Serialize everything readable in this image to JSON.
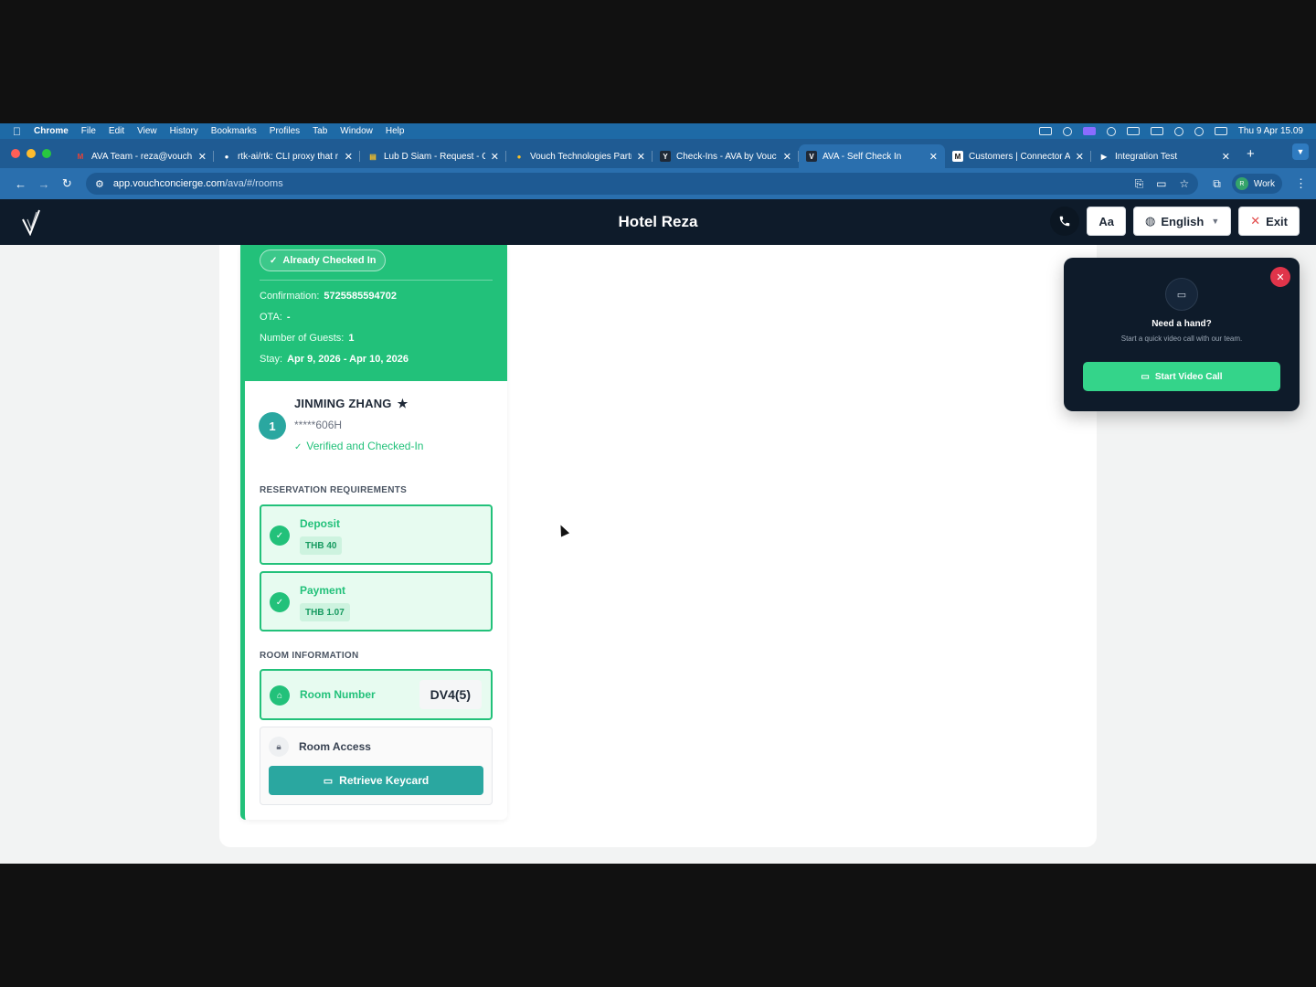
{
  "menubar": {
    "app": "Chrome",
    "items": [
      "File",
      "Edit",
      "View",
      "History",
      "Bookmarks",
      "Profiles",
      "Tab",
      "Window",
      "Help"
    ],
    "clock": "Thu 9 Apr  15.09"
  },
  "tabs": [
    {
      "title": "AVA Team - reza@vouch",
      "fav": "M",
      "color": "#ea4335"
    },
    {
      "title": "rtk-ai/rtk: CLI proxy that r",
      "fav": "●",
      "color": "#ffffff"
    },
    {
      "title": "Lub D Siam - Request - G",
      "fav": "▤",
      "color": "#f6c026"
    },
    {
      "title": "Vouch Technologies Partn",
      "fav": "●",
      "color": "#f6c026"
    },
    {
      "title": "Check-Ins - AVA by Vouc",
      "fav": "Y",
      "color": "#1f2937"
    },
    {
      "title": "AVA - Self Check In",
      "fav": "V",
      "color": "#1f2937"
    },
    {
      "title": "Customers | Connector A",
      "fav": "M",
      "color": "#111111"
    },
    {
      "title": "Integration Test",
      "fav": "▶",
      "color": "#ffffff"
    }
  ],
  "address": {
    "host": "app.vouchconcierge.com",
    "path": "/ava/#/rooms"
  },
  "profile": {
    "initial": "R",
    "label": "Work"
  },
  "header": {
    "hotel": "Hotel Reza",
    "font_button": "Aa",
    "language": "English",
    "exit": "Exit"
  },
  "booking": {
    "status": "Already Checked In",
    "confirmation_label": "Confirmation:",
    "confirmation": "5725585594702",
    "ota_label": "OTA:",
    "ota": "-",
    "guests_label": "Number of Guests:",
    "guests": "1",
    "stay_label": "Stay:",
    "stay": "Apr 9, 2026 - Apr 10, 2026"
  },
  "guest": {
    "number": "1",
    "name": "JINMING ZHANG",
    "id": "*****606H",
    "status": "Verified and Checked-In"
  },
  "requirements": {
    "heading": "RESERVATION REQUIREMENTS",
    "items": [
      {
        "label": "Deposit",
        "amount": "THB 40"
      },
      {
        "label": "Payment",
        "amount": "THB 1.07"
      }
    ]
  },
  "room": {
    "heading": "ROOM INFORMATION",
    "number_label": "Room Number",
    "number": "DV4(5)",
    "access_label": "Room Access",
    "keycard_button": "Retrieve Keycard"
  },
  "video": {
    "title": "Need a hand?",
    "subtitle": "Start a quick video call with our team.",
    "button": "Start Video Call"
  },
  "colors": {
    "accent": "#22c17a",
    "teal": "#2aa7a0",
    "header": "#0e1b2a",
    "chrome": "#1f5b93"
  }
}
